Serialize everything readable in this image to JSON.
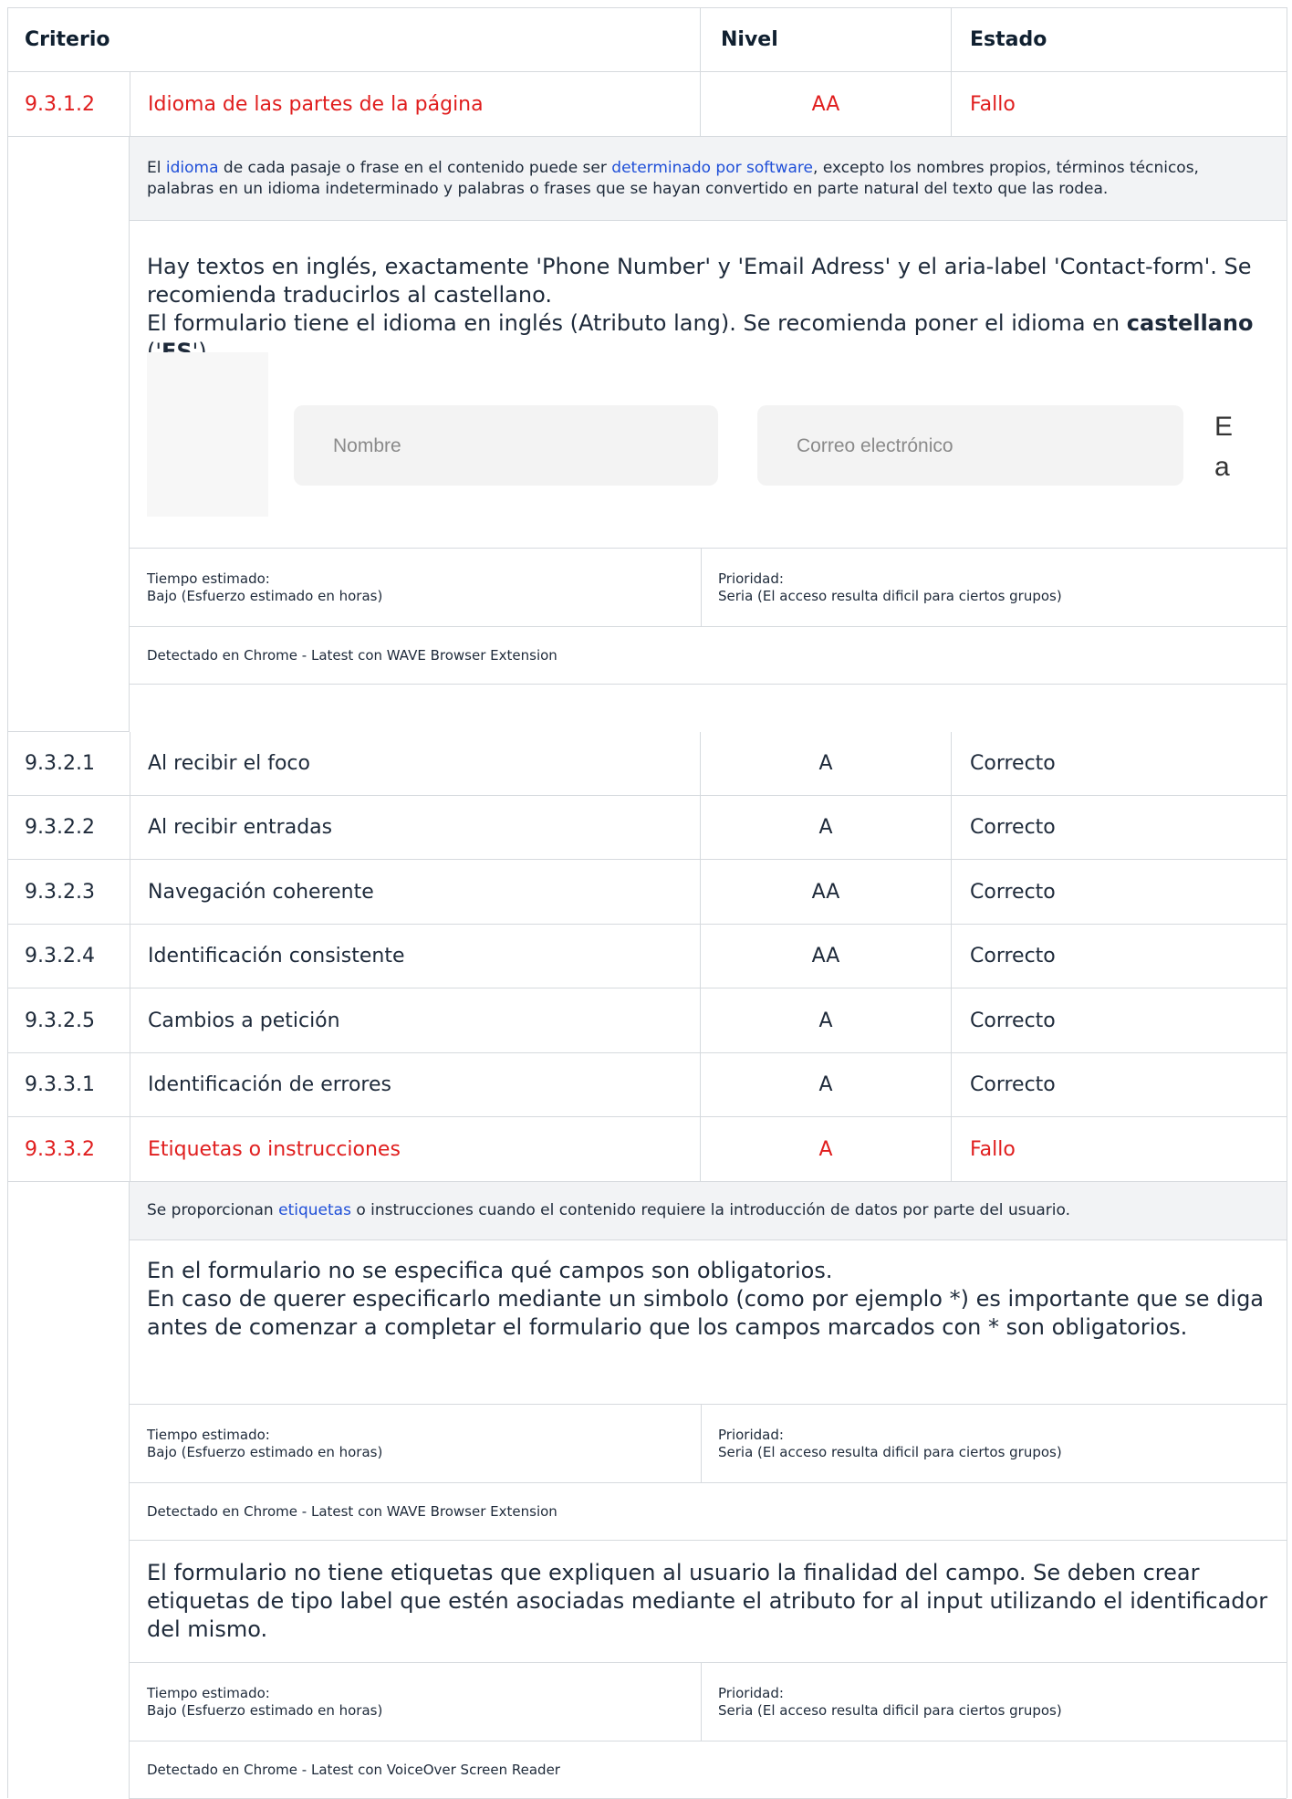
{
  "header": {
    "criterio": "Criterio",
    "nivel": "Nivel",
    "estado": "Estado"
  },
  "rows": [
    {
      "id": "9.3.1.2",
      "name": "Idioma de las partes de la página",
      "level": "AA",
      "status": "Fallo"
    },
    {
      "id": "9.3.2.1",
      "name": "Al recibir el foco",
      "level": "A",
      "status": "Correcto"
    },
    {
      "id": "9.3.2.2",
      "name": "Al recibir entradas",
      "level": "A",
      "status": "Correcto"
    },
    {
      "id": "9.3.2.3",
      "name": "Navegación coherente",
      "level": "AA",
      "status": "Correcto"
    },
    {
      "id": "9.3.2.4",
      "name": "Identificación consistente",
      "level": "AA",
      "status": "Correcto"
    },
    {
      "id": "9.3.2.5",
      "name": "Cambios a petición",
      "level": "A",
      "status": "Correcto"
    },
    {
      "id": "9.3.3.1",
      "name": "Identificación de errores",
      "level": "A",
      "status": "Correcto"
    },
    {
      "id": "9.3.3.2",
      "name": "Etiquetas o instrucciones",
      "level": "A",
      "status": "Fallo"
    }
  ],
  "d1": {
    "desc_pre": "El ",
    "desc_link1": "idioma",
    "desc_mid": " de cada pasaje o frase en el contenido puede ser ",
    "desc_link2": "determinado por software",
    "desc_post": ", excepto los nombres propios, términos técnicos, palabras en un idioma indeterminado y palabras o frases que se hayan convertido en parte natural del texto que las rodea.",
    "note_line1": "Hay textos en inglés, exactamente 'Phone Number' y 'Email Adress' y el aria-label 'Contact-form'. Se recomienda traducirlos al castellano.",
    "note_line2": "El formulario tiene el idioma en inglés (Atributo lang). Se recomienda poner el idioma en ",
    "note_bold1": "castellano",
    "note_q1": " ('",
    "note_bold2": "ES",
    "note_q2": "')",
    "screenshot": {
      "field1": "Nombre",
      "field2": "Correo electrónico",
      "frag1": "E",
      "frag2": "a"
    },
    "tiempo_label": "Tiempo estimado:",
    "tiempo_value": "Bajo (Esfuerzo estimado en horas)",
    "prioridad_label": "Prioridad:",
    "prioridad_value": "Seria (El acceso resulta dificil para ciertos grupos)",
    "detected": "Detectado en Chrome - Latest con WAVE Browser Extension"
  },
  "d2": {
    "desc_pre": "Se proporcionan ",
    "desc_link": "etiquetas",
    "desc_post": " o instrucciones cuando el contenido requiere la introducción de datos por parte del usuario.",
    "note1": "En el formulario no se especifica qué campos son obligatorios.",
    "note1b": "En caso de querer especificarlo mediante un simbolo (como por ejemplo *) es importante que se diga antes de comenzar a completar el formulario que los campos marcados con * son obligatorios.",
    "tiempo_label": "Tiempo estimado:",
    "tiempo_value": "Bajo (Esfuerzo estimado en horas)",
    "prioridad_label": "Prioridad:",
    "prioridad_value": "Seria (El acceso resulta dificil para ciertos grupos)",
    "detected1": "Detectado en Chrome - Latest con WAVE Browser Extension",
    "note2": "El formulario no tiene etiquetas que expliquen al usuario la finalidad del campo. Se deben crear etiquetas de tipo label que estén asociadas mediante el atributo for al input utilizando el identificador del mismo.",
    "tiempo2_label": "Tiempo estimado:",
    "tiempo2_value": "Bajo (Esfuerzo estimado en horas)",
    "prioridad2_label": "Prioridad:",
    "prioridad2_value": "Seria (El acceso resulta dificil para ciertos grupos)",
    "detected2": "Detectado en Chrome - Latest con VoiceOver Screen Reader"
  },
  "colors": {
    "fail": "#e01e1e",
    "link": "#1f4fd8",
    "border": "#d6dade",
    "desc_bg": "#f2f3f5"
  }
}
